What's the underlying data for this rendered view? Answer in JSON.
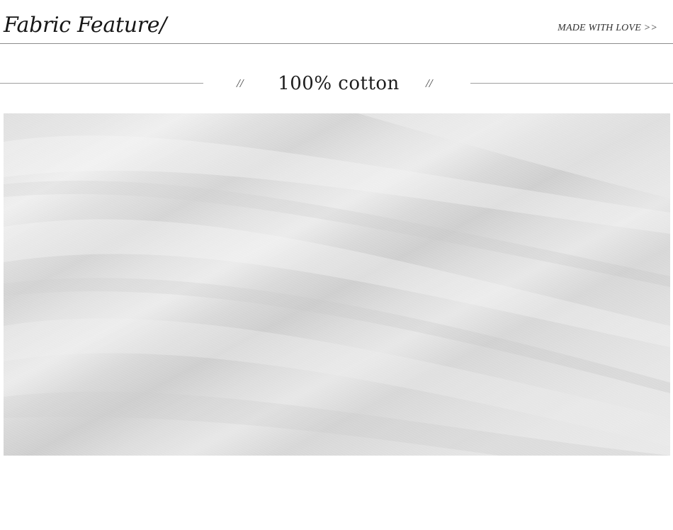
{
  "header": {
    "title": "Fabric Feature/",
    "tagline": "MADE WITH LOVE >>"
  },
  "section": {
    "left_slashes": "//",
    "heading": "100% cotton",
    "right_slashes": "//"
  },
  "photo": {
    "subject": "fabric-closeup"
  }
}
